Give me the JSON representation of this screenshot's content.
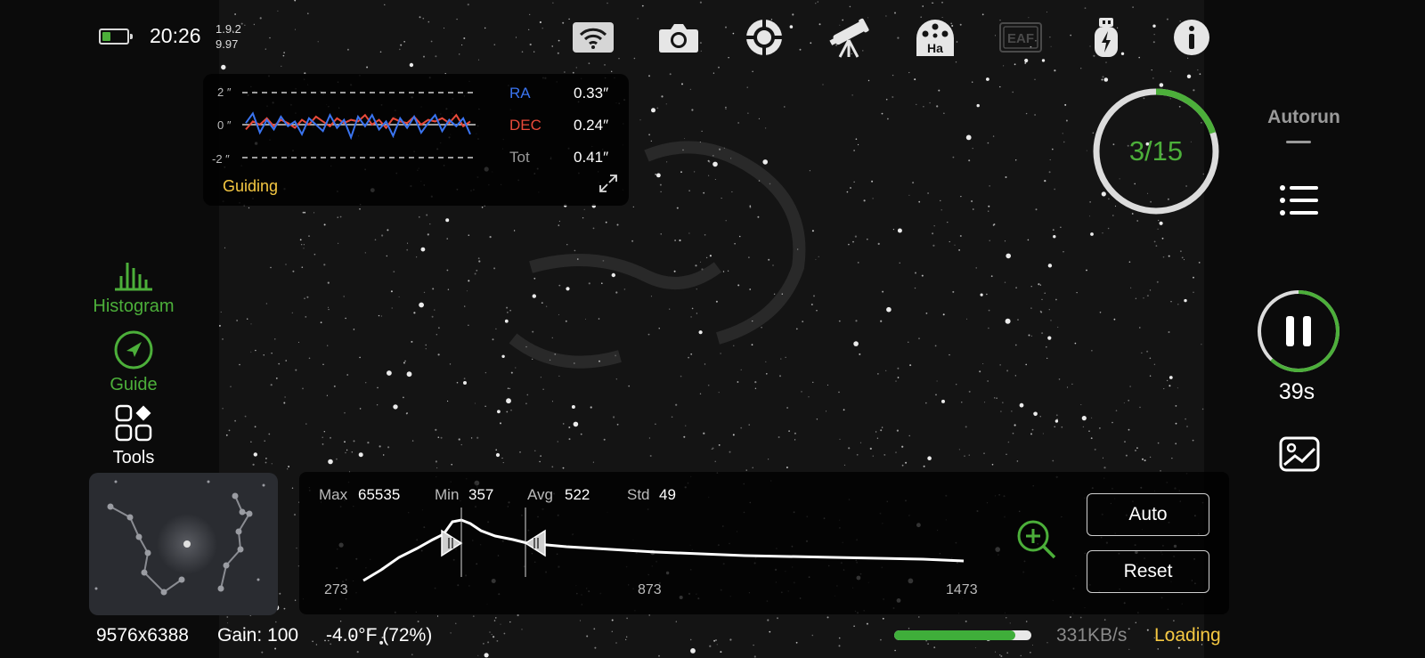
{
  "status": {
    "time": "20:26",
    "version_line1": "1.9.2",
    "version_line2": "9.97",
    "battery_level": 0.35,
    "battery_color": "#4caf3a"
  },
  "top_icons": [
    {
      "name": "wifi-icon",
      "label": ""
    },
    {
      "name": "camera-icon",
      "label": ""
    },
    {
      "name": "target-icon",
      "label": ""
    },
    {
      "name": "telescope-icon",
      "label": ""
    },
    {
      "name": "filter-wheel-icon",
      "label": "Ha"
    },
    {
      "name": "eaf-icon",
      "label": "EAF"
    },
    {
      "name": "usb-power-icon",
      "label": ""
    },
    {
      "name": "info-icon",
      "label": ""
    }
  ],
  "guiding": {
    "title": "Guiding",
    "axis_top": "2 ″",
    "axis_mid": "0 ″",
    "axis_bottom": "-2 ″",
    "ra_label": "RA",
    "ra_value": "0.33″",
    "dec_label": "DEC",
    "dec_value": "0.24″",
    "tot_label": "Tot",
    "tot_value": "0.41″",
    "ra_color": "#3a74f0",
    "dec_color": "#e84a3a",
    "ra_series": [
      0.1,
      0.7,
      -0.5,
      0.3,
      -0.3,
      0.5,
      -0.1,
      0.2,
      -0.6,
      0.4,
      0.0,
      -0.4,
      0.6,
      -0.2,
      0.3,
      -0.8,
      0.5,
      -0.1,
      0.6,
      -0.3,
      0.2,
      -0.7,
      0.4,
      -0.2,
      0.5,
      -0.5,
      0.1,
      0.6,
      -0.4,
      0.3,
      -0.1,
      0.4,
      -0.6
    ],
    "dec_series": [
      -0.3,
      0.2,
      0.0,
      0.4,
      -0.1,
      0.3,
      0.1,
      -0.2,
      0.3,
      0.0,
      0.5,
      0.2,
      -0.1,
      0.4,
      0.1,
      0.3,
      0.2,
      0.6,
      0.0,
      0.3,
      -0.2,
      0.4,
      0.2,
      0.1,
      0.5,
      0.0,
      0.3,
      0.2,
      0.4,
      0.1,
      0.6,
      -0.1,
      0.2
    ]
  },
  "sequence": {
    "current": 3,
    "total": 15,
    "text": "3/15",
    "accent": "#4caf3a"
  },
  "side_tools": {
    "histogram_label": "Histogram",
    "guide_label": "Guide",
    "tools_label": "Tools",
    "active_color": "#4caf3a"
  },
  "histogram": {
    "max_label": "Max",
    "max_value": "65535",
    "min_label": "Min",
    "min_value": "357",
    "avg_label": "Avg",
    "avg_value": "522",
    "std_label": "Std",
    "std_value": "49",
    "axis_left": "273",
    "axis_mid": "873",
    "axis_right": "1473",
    "auto_label": "Auto",
    "reset_label": "Reset"
  },
  "bottom": {
    "resolution": "9576x6388",
    "gain": "Gain: 100",
    "temperature": "-4.0°F (72%)",
    "speed": "331KB/s",
    "loading": "Loading",
    "download_progress": 0.88
  },
  "right": {
    "autorun_label": "Autorun",
    "timer": "39s",
    "exposure_progress": 0.62
  }
}
